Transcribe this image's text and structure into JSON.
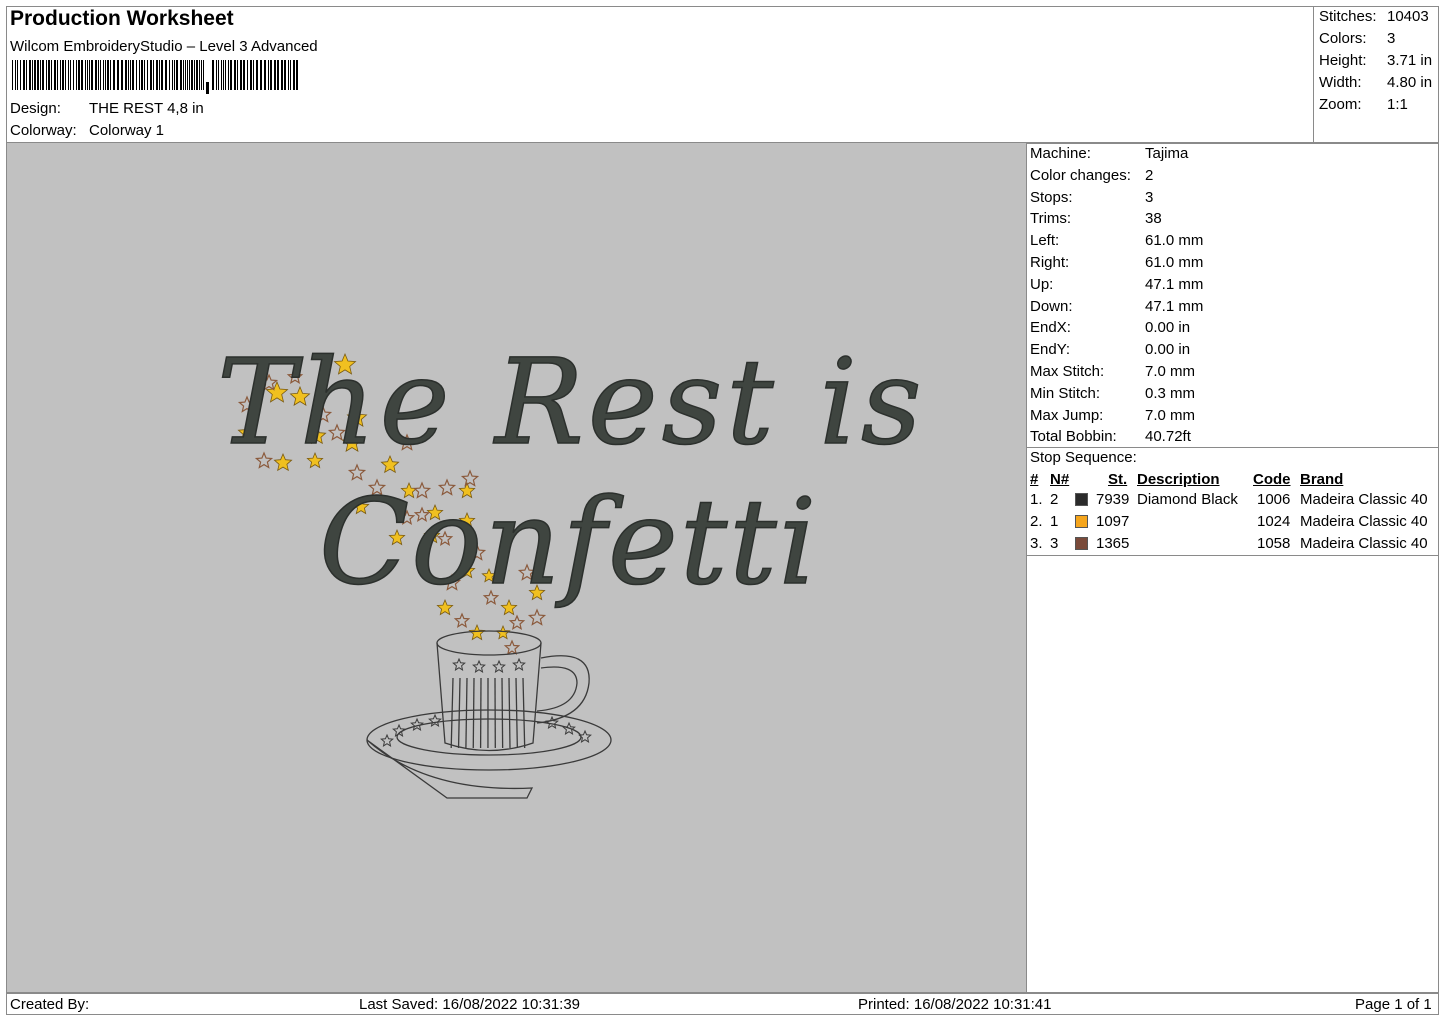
{
  "header": {
    "title": "Production Worksheet",
    "software": "Wilcom EmbroideryStudio – Level 3 Advanced",
    "design_label": "Design:",
    "design_value": "THE REST 4,8 in",
    "colorway_label": "Colorway:",
    "colorway_value": "Colorway 1"
  },
  "stats": [
    {
      "label": "Stitches:",
      "value": "10403"
    },
    {
      "label": "Colors:",
      "value": "3"
    },
    {
      "label": "Height:",
      "value": "3.71 in"
    },
    {
      "label": "Width:",
      "value": "4.80 in"
    },
    {
      "label": "Zoom:",
      "value": "1:1"
    }
  ],
  "machine_info": [
    {
      "label": "Machine:",
      "value": "Tajima"
    },
    {
      "label": "Color changes:",
      "value": "2"
    },
    {
      "label": "Stops:",
      "value": "3"
    },
    {
      "label": "Trims:",
      "value": "38"
    },
    {
      "label": "Left:",
      "value": "61.0 mm"
    },
    {
      "label": "Right:",
      "value": "61.0 mm"
    },
    {
      "label": "Up:",
      "value": "47.1 mm"
    },
    {
      "label": "Down:",
      "value": "47.1 mm"
    },
    {
      "label": "EndX:",
      "value": "0.00 in"
    },
    {
      "label": "EndY:",
      "value": "0.00 in"
    },
    {
      "label": "Max Stitch:",
      "value": "7.0 mm"
    },
    {
      "label": "Min Stitch:",
      "value": "0.3 mm"
    },
    {
      "label": "Max Jump:",
      "value": "7.0 mm"
    },
    {
      "label": "Total Bobbin:",
      "value": "40.72ft"
    }
  ],
  "stop_sequence": {
    "title": "Stop Sequence:",
    "headers": {
      "num": "#",
      "n": "N#",
      "st": "St.",
      "description": "Description",
      "code": "Code",
      "brand": "Brand"
    },
    "rows": [
      {
        "num": "1.",
        "n": "2",
        "color": "#2b2b2b",
        "st": "7939",
        "description": "Diamond Black",
        "code": "1006",
        "brand": "Madeira Classic 40"
      },
      {
        "num": "2.",
        "n": "1",
        "color": "#f5a51c",
        "st": "1097",
        "description": "",
        "code": "1024",
        "brand": "Madeira Classic 40"
      },
      {
        "num": "3.",
        "n": "3",
        "color": "#7a4a3a",
        "st": "1365",
        "description": "",
        "code": "1058",
        "brand": "Madeira Classic 40"
      }
    ]
  },
  "design_preview": {
    "line1": "The Rest is",
    "line2": "Confetti",
    "text_color": "#3f4540",
    "star_gold": "#f0c020",
    "star_brown": "#8b5a3c",
    "background": "#c1c1c1"
  },
  "footer": {
    "created_by": "Created By:",
    "last_saved": "Last Saved: 16/08/2022 10:31:39",
    "printed": "Printed: 16/08/2022 10:31:41",
    "page": "Page 1 of 1"
  }
}
